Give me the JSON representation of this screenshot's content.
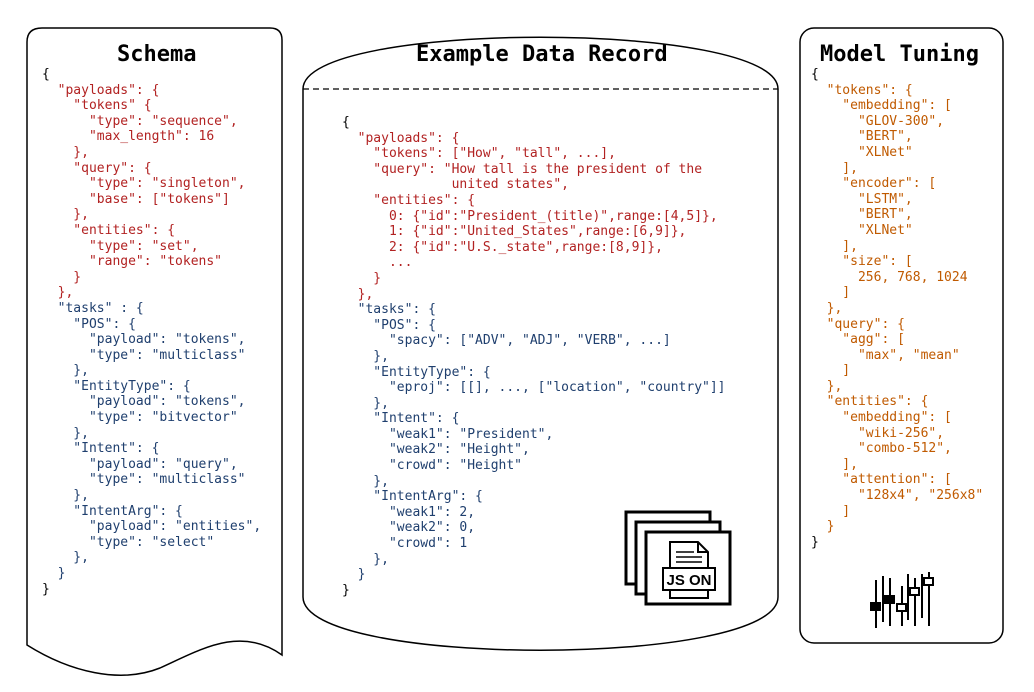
{
  "colors": {
    "black": "#000000",
    "red": "#b22222",
    "blue": "#1f3f6e",
    "orange": "#c05a00"
  },
  "panels": {
    "schema": {
      "title": "Schema",
      "lines": [
        [
          {
            "t": "{",
            "c": "black"
          }
        ],
        [
          {
            "t": "  \"payloads\": {",
            "c": "red"
          }
        ],
        [
          {
            "t": "    \"tokens\" {",
            "c": "red"
          }
        ],
        [
          {
            "t": "      \"type\": \"sequence\",",
            "c": "red"
          }
        ],
        [
          {
            "t": "      \"max_length\": 16",
            "c": "red"
          }
        ],
        [
          {
            "t": "    },",
            "c": "red"
          }
        ],
        [
          {
            "t": "    \"query\": {",
            "c": "red"
          }
        ],
        [
          {
            "t": "      \"type\": \"singleton\",",
            "c": "red"
          }
        ],
        [
          {
            "t": "      \"base\": [\"tokens\"]",
            "c": "red"
          }
        ],
        [
          {
            "t": "    },",
            "c": "red"
          }
        ],
        [
          {
            "t": "    \"entities\": {",
            "c": "red"
          }
        ],
        [
          {
            "t": "      \"type\": \"set\",",
            "c": "red"
          }
        ],
        [
          {
            "t": "      \"range\": \"tokens\"",
            "c": "red"
          }
        ],
        [
          {
            "t": "    }",
            "c": "red"
          }
        ],
        [
          {
            "t": "  },",
            "c": "red"
          }
        ],
        [
          {
            "t": "  \"tasks\" : {",
            "c": "blue"
          }
        ],
        [
          {
            "t": "    \"POS\": {",
            "c": "blue"
          }
        ],
        [
          {
            "t": "      \"payload\": \"tokens\",",
            "c": "blue"
          }
        ],
        [
          {
            "t": "      \"type\": \"multiclass\"",
            "c": "blue"
          }
        ],
        [
          {
            "t": "    },",
            "c": "blue"
          }
        ],
        [
          {
            "t": "    \"EntityType\": {",
            "c": "blue"
          }
        ],
        [
          {
            "t": "      \"payload\": \"tokens\",",
            "c": "blue"
          }
        ],
        [
          {
            "t": "      \"type\": \"bitvector\"",
            "c": "blue"
          }
        ],
        [
          {
            "t": "    },",
            "c": "blue"
          }
        ],
        [
          {
            "t": "    \"Intent\": {",
            "c": "blue"
          }
        ],
        [
          {
            "t": "      \"payload\": \"query\",",
            "c": "blue"
          }
        ],
        [
          {
            "t": "      \"type\": \"multiclass\"",
            "c": "blue"
          }
        ],
        [
          {
            "t": "    },",
            "c": "blue"
          }
        ],
        [
          {
            "t": "    \"IntentArg\": {",
            "c": "blue"
          }
        ],
        [
          {
            "t": "      \"payload\": \"entities\",",
            "c": "blue"
          }
        ],
        [
          {
            "t": "      \"type\": \"select\"",
            "c": "blue"
          }
        ],
        [
          {
            "t": "    },",
            "c": "blue"
          }
        ],
        [
          {
            "t": "  }",
            "c": "blue"
          }
        ],
        [
          {
            "t": "}",
            "c": "black"
          }
        ]
      ]
    },
    "record": {
      "title": "Example Data Record",
      "icon_text": "JS ON",
      "lines": [
        [
          {
            "t": "{",
            "c": "black"
          }
        ],
        [
          {
            "t": "  \"payloads\": {",
            "c": "red"
          }
        ],
        [
          {
            "t": "    \"tokens\": [\"How\", \"tall\", ...],",
            "c": "red"
          }
        ],
        [
          {
            "t": "    \"query\": \"How tall is the president of the",
            "c": "red"
          }
        ],
        [
          {
            "t": "              united states\",",
            "c": "red"
          }
        ],
        [
          {
            "t": "    \"entities\": {",
            "c": "red"
          }
        ],
        [
          {
            "t": "      0: {\"id\":\"President_(title)\",range:[4,5]},",
            "c": "red"
          }
        ],
        [
          {
            "t": "      1: {\"id\":\"United_States\",range:[6,9]},",
            "c": "red"
          }
        ],
        [
          {
            "t": "      2: {\"id\":\"U.S._state\",range:[8,9]},",
            "c": "red"
          }
        ],
        [
          {
            "t": "      ...",
            "c": "red"
          }
        ],
        [
          {
            "t": "    }",
            "c": "red"
          }
        ],
        [
          {
            "t": "  },",
            "c": "red"
          }
        ],
        [
          {
            "t": "  \"tasks\": {",
            "c": "blue"
          }
        ],
        [
          {
            "t": "    \"POS\": {",
            "c": "blue"
          }
        ],
        [
          {
            "t": "      \"spacy\": [\"ADV\", \"ADJ\", \"VERB\", ...]",
            "c": "blue"
          }
        ],
        [
          {
            "t": "    },",
            "c": "blue"
          }
        ],
        [
          {
            "t": "    \"EntityType\": {",
            "c": "blue"
          }
        ],
        [
          {
            "t": "      \"eproj\": [[], ..., [\"location\", \"country\"]]",
            "c": "blue"
          }
        ],
        [
          {
            "t": "    },",
            "c": "blue"
          }
        ],
        [
          {
            "t": "    \"Intent\": {",
            "c": "blue"
          }
        ],
        [
          {
            "t": "      \"weak1\": \"President\",",
            "c": "blue"
          }
        ],
        [
          {
            "t": "      \"weak2\": \"Height\",",
            "c": "blue"
          }
        ],
        [
          {
            "t": "      \"crowd\": \"Height\"",
            "c": "blue"
          }
        ],
        [
          {
            "t": "    },",
            "c": "blue"
          }
        ],
        [
          {
            "t": "    \"IntentArg\": {",
            "c": "blue"
          }
        ],
        [
          {
            "t": "      \"weak1\": 2,",
            "c": "blue"
          }
        ],
        [
          {
            "t": "      \"weak2\": 0,",
            "c": "blue"
          }
        ],
        [
          {
            "t": "      \"crowd\": 1",
            "c": "blue"
          }
        ],
        [
          {
            "t": "    },",
            "c": "blue"
          }
        ],
        [
          {
            "t": "  }",
            "c": "blue"
          }
        ],
        [
          {
            "t": "}",
            "c": "black"
          }
        ]
      ]
    },
    "tuning": {
      "title": "Model Tuning",
      "lines": [
        [
          {
            "t": "{",
            "c": "black"
          }
        ],
        [
          {
            "t": "  \"tokens\": {",
            "c": "orange"
          }
        ],
        [
          {
            "t": "    \"embedding\": [",
            "c": "orange"
          }
        ],
        [
          {
            "t": "      \"GLOV-300\",",
            "c": "orange"
          }
        ],
        [
          {
            "t": "      \"BERT\",",
            "c": "orange"
          }
        ],
        [
          {
            "t": "      \"XLNet\"",
            "c": "orange"
          }
        ],
        [
          {
            "t": "    ],",
            "c": "orange"
          }
        ],
        [
          {
            "t": "    \"encoder\": [",
            "c": "orange"
          }
        ],
        [
          {
            "t": "      \"LSTM\",",
            "c": "orange"
          }
        ],
        [
          {
            "t": "      \"BERT\",",
            "c": "orange"
          }
        ],
        [
          {
            "t": "      \"XLNet\"",
            "c": "orange"
          }
        ],
        [
          {
            "t": "    ],",
            "c": "orange"
          }
        ],
        [
          {
            "t": "    \"size\": [",
            "c": "orange"
          }
        ],
        [
          {
            "t": "      256, 768, 1024",
            "c": "orange"
          }
        ],
        [
          {
            "t": "    ]",
            "c": "orange"
          }
        ],
        [
          {
            "t": "  },",
            "c": "orange"
          }
        ],
        [
          {
            "t": "  \"query\": {",
            "c": "orange"
          }
        ],
        [
          {
            "t": "    \"agg\": [",
            "c": "orange"
          }
        ],
        [
          {
            "t": "      \"max\", \"mean\"",
            "c": "orange"
          }
        ],
        [
          {
            "t": "    ]",
            "c": "orange"
          }
        ],
        [
          {
            "t": "  },",
            "c": "orange"
          }
        ],
        [
          {
            "t": "  \"entities\": {",
            "c": "orange"
          }
        ],
        [
          {
            "t": "    \"embedding\": [",
            "c": "orange"
          }
        ],
        [
          {
            "t": "      \"wiki-256\",",
            "c": "orange"
          }
        ],
        [
          {
            "t": "      \"combo-512\",",
            "c": "orange"
          }
        ],
        [
          {
            "t": "    ],",
            "c": "orange"
          }
        ],
        [
          {
            "t": "    \"attention\": [",
            "c": "orange"
          }
        ],
        [
          {
            "t": "      \"128x4\", \"256x8\"",
            "c": "orange"
          }
        ],
        [
          {
            "t": "    ]",
            "c": "orange"
          }
        ],
        [
          {
            "t": "  }",
            "c": "orange"
          }
        ],
        [
          {
            "t": "}",
            "c": "black"
          }
        ]
      ]
    }
  }
}
